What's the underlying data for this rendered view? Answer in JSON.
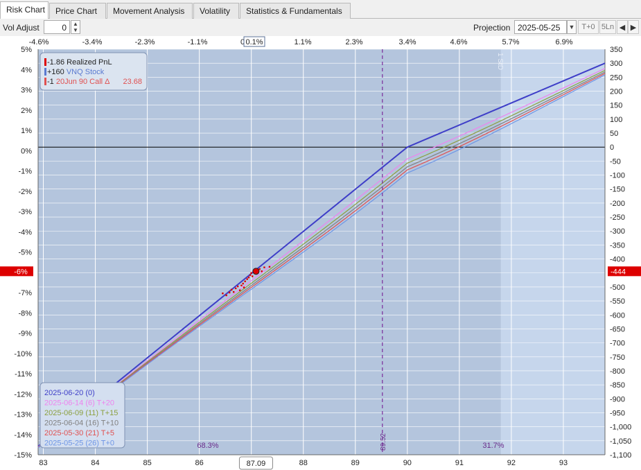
{
  "tabs": [
    {
      "label": "Risk Chart",
      "active": true
    },
    {
      "label": "Price Chart",
      "active": false
    },
    {
      "label": "Movement Analysis",
      "active": false
    },
    {
      "label": "Volatility",
      "active": false
    },
    {
      "label": "Statistics & Fundamentals",
      "active": false
    }
  ],
  "toolbar": {
    "vol_adjust_label": "Vol Adjust",
    "vol_adjust_value": "0",
    "projection_label": "Projection",
    "projection_date": "2025-05-25",
    "t0_label": "T+0",
    "fivel_label": "5Ln",
    "prev_icon": "triangle-left-icon",
    "next_icon": "triangle-right-icon"
  },
  "colors": {
    "plot_bg": "#b4c5dd",
    "plot_bg_right": "#c6d6ec",
    "expiry_line": "#3e3ec8",
    "t20_line": "#ee82ee",
    "t15_line": "#8ca040",
    "t10_line": "#808080",
    "t5_line": "#e05050",
    "t0_line": "#6e96e6",
    "current_marker": "#dd0000",
    "vertical_line": "#7a2a9a"
  },
  "chart_data": {
    "type": "line",
    "xlim": [
      82.9,
      93.8
    ],
    "ylim": [
      -1100,
      350
    ],
    "x_ticks": [
      "83",
      "84",
      "85",
      "86",
      "87",
      "88",
      "89",
      "90",
      "91",
      "92",
      "93"
    ],
    "current_price_label": "87.09",
    "pct_ticks_top": [
      "-4.6%",
      "-3.4%",
      "-2.3%",
      "-1.1%",
      "0%",
      "0.1%",
      "1.1%",
      "2.3%",
      "3.4%",
      "4.6%",
      "5.7%",
      "6.9%"
    ],
    "left_pct_ticks": [
      "5%",
      "4%",
      "3%",
      "2%",
      "1%",
      "0%",
      "-1%",
      "-2%",
      "-3%",
      "-4%",
      "-5%",
      "-6%",
      "-7%",
      "-8%",
      "-9%",
      "-10%",
      "-11%",
      "-12%",
      "-13%",
      "-14%",
      "-15%"
    ],
    "left_current_label": "-6%",
    "right_ticks": [
      "350",
      "300",
      "250",
      "200",
      "150",
      "100",
      "50",
      "0",
      "-50",
      "-100",
      "-150",
      "-200",
      "-250",
      "-300",
      "-350",
      "-400",
      "-450",
      "-500",
      "-550",
      "-600",
      "-650",
      "-700",
      "-750",
      "-800",
      "-850",
      "-900",
      "-950",
      "-1,000",
      "-1,050",
      "-1,100"
    ],
    "right_current_label": "-444",
    "breakeven_x": 89.52,
    "breakeven_label": "89.52",
    "prob_left_label": "68.3%",
    "prob_right_label": "31.7%",
    "sigma_label": "1 StD",
    "range_end_x": 91.8,
    "current": {
      "x": 87.09,
      "y": -444
    },
    "positions_legend": [
      {
        "text1": "-1.86",
        "text2": "Realized PnL",
        "color": "#dd0000"
      },
      {
        "text1": "+160",
        "text2": "VNQ Stock",
        "color": "#5a7ad0"
      },
      {
        "text1": "-1",
        "text2": "20Jun 90 Call Δ",
        "extra": "23.68",
        "color": "#e05050"
      }
    ],
    "series": [
      {
        "name": "2025-06-20 (0)",
        "tag": "",
        "color": "#3e3ec8",
        "k": 0,
        "points": [
          [
            82.9,
            -1070
          ],
          [
            90,
            0
          ],
          [
            93.8,
            300
          ]
        ]
      },
      {
        "name": "2025-06-14 (6)",
        "tag": "T+20",
        "color": "#ee82ee",
        "k": 0.38
      },
      {
        "name": "2025-06-09 (11)",
        "tag": "T+15",
        "color": "#8ca040",
        "k": 0.52
      },
      {
        "name": "2025-06-04 (16)",
        "tag": "T+10",
        "color": "#808080",
        "k": 0.64
      },
      {
        "name": "2025-05-30 (21)",
        "tag": "T+5",
        "color": "#e05050",
        "k": 0.74
      },
      {
        "name": "2025-05-25 (26)",
        "tag": "T+0",
        "color": "#6e96e6",
        "k": 0.84
      }
    ],
    "scatter_points": [
      [
        86.45,
        -523
      ],
      [
        86.52,
        -530
      ],
      [
        86.58,
        -520
      ],
      [
        86.62,
        -510
      ],
      [
        86.66,
        -518
      ],
      [
        86.7,
        -505
      ],
      [
        86.74,
        -498
      ],
      [
        86.78,
        -512
      ],
      [
        86.81,
        -495
      ],
      [
        86.84,
        -488
      ],
      [
        86.86,
        -502
      ],
      [
        86.88,
        -480
      ],
      [
        86.92,
        -472
      ],
      [
        86.95,
        -466
      ],
      [
        86.98,
        -458
      ],
      [
        87.0,
        -450
      ],
      [
        87.02,
        -462
      ],
      [
        87.05,
        -445
      ],
      [
        87.08,
        -452
      ],
      [
        87.1,
        -440
      ],
      [
        87.13,
        -448
      ],
      [
        87.16,
        -436
      ],
      [
        87.2,
        -444
      ],
      [
        87.25,
        -430
      ],
      [
        87.35,
        -428
      ]
    ]
  }
}
